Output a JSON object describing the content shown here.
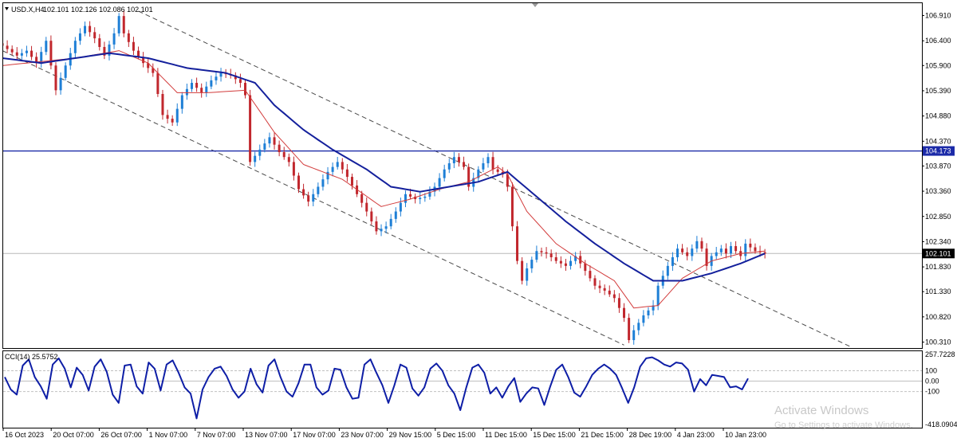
{
  "header": {
    "symbol": "USD.X,H4",
    "ohlc": "102.101 102.126 102.086 102.101"
  },
  "indicator": {
    "label": "CCI(14) 25.5752"
  },
  "watermark": {
    "line1": "Activate Windows",
    "line2": "Go to Settings to activate Windows."
  },
  "colors": {
    "bull": "#1e7fd6",
    "bear": "#c1272d",
    "ma_fast": "#d23b3b",
    "ma_slow": "#14209c",
    "hline": "#1b2aa8",
    "cci": "#0e1ea6",
    "channel": "#4a4a4a"
  },
  "chart_data": [
    {
      "type": "candlestick",
      "series_name": "USD.X,H4",
      "price_axis_ticks": [
        "106.910",
        "106.400",
        "105.900",
        "105.390",
        "104.880",
        "104.370",
        "103.870",
        "103.360",
        "102.850",
        "102.340",
        "101.830",
        "101.330",
        "100.820",
        "100.310"
      ],
      "ylim": [
        100.19,
        107.16
      ],
      "date_labels": [
        "16 Oct 2023",
        "20 Oct 07:00",
        "26 Oct 07:00",
        "1 Nov 07:00",
        "7 Nov 07:00",
        "13 Nov 07:00",
        "17 Nov 07:00",
        "23 Nov 07:00",
        "29 Nov 15:00",
        "5 Dec 15:00",
        "11 Dec 15:00",
        "15 Dec 15:00",
        "21 Dec 15:00",
        "28 Dec 19:00",
        "4 Jan 23:00",
        "10 Jan 23:00"
      ],
      "horizontal_line": 104.173,
      "current_price": 102.101,
      "close_path": [
        [
          0,
          106.3
        ],
        [
          3,
          106.1
        ],
        [
          5,
          106.2
        ],
        [
          7,
          105.95
        ],
        [
          9,
          106.4
        ],
        [
          10,
          105.9
        ],
        [
          11,
          105.4
        ],
        [
          13,
          105.9
        ],
        [
          15,
          106.4
        ],
        [
          17,
          106.7
        ],
        [
          19,
          106.45
        ],
        [
          21,
          106.1
        ],
        [
          23,
          106.55
        ],
        [
          24,
          106.9
        ],
        [
          25,
          106.55
        ],
        [
          27,
          106.2
        ],
        [
          29,
          105.95
        ],
        [
          31,
          105.75
        ],
        [
          33,
          104.9
        ],
        [
          35,
          104.75
        ],
        [
          37,
          105.3
        ],
        [
          39,
          105.55
        ],
        [
          41,
          105.35
        ],
        [
          43,
          105.6
        ],
        [
          45,
          105.75
        ],
        [
          47,
          105.7
        ],
        [
          49,
          105.55
        ],
        [
          50,
          105.3
        ],
        [
          51,
          103.95
        ],
        [
          53,
          104.2
        ],
        [
          55,
          104.45
        ],
        [
          57,
          104.15
        ],
        [
          59,
          103.95
        ],
        [
          61,
          103.4
        ],
        [
          63,
          103.15
        ],
        [
          65,
          103.45
        ],
        [
          67,
          103.75
        ],
        [
          69,
          103.95
        ],
        [
          71,
          103.65
        ],
        [
          73,
          103.3
        ],
        [
          75,
          102.95
        ],
        [
          77,
          102.55
        ],
        [
          79,
          102.65
        ],
        [
          81,
          102.95
        ],
        [
          83,
          103.3
        ],
        [
          85,
          103.2
        ],
        [
          87,
          103.25
        ],
        [
          89,
          103.45
        ],
        [
          91,
          103.8
        ],
        [
          93,
          104.05
        ],
        [
          95,
          103.85
        ],
        [
          96,
          103.45
        ],
        [
          98,
          103.8
        ],
        [
          100,
          104.05
        ],
        [
          101,
          103.8
        ],
        [
          103,
          103.7
        ],
        [
          104,
          103.45
        ],
        [
          105,
          102.65
        ],
        [
          106,
          101.95
        ],
        [
          107,
          101.55
        ],
        [
          108,
          101.8
        ],
        [
          110,
          102.15
        ],
        [
          112,
          102.1
        ],
        [
          114,
          101.95
        ],
        [
          116,
          101.85
        ],
        [
          118,
          102.05
        ],
        [
          120,
          101.75
        ],
        [
          122,
          101.45
        ],
        [
          124,
          101.35
        ],
        [
          126,
          101.2
        ],
        [
          128,
          100.8
        ],
        [
          129,
          100.35
        ],
        [
          130,
          100.55
        ],
        [
          132,
          100.85
        ],
        [
          134,
          101.05
        ],
        [
          135,
          101.45
        ],
        [
          137,
          101.85
        ],
        [
          139,
          102.2
        ],
        [
          141,
          102.05
        ],
        [
          143,
          102.35
        ],
        [
          144,
          102.2
        ],
        [
          145,
          101.85
        ],
        [
          146,
          102.05
        ],
        [
          148,
          102.2
        ],
        [
          149,
          102.1
        ],
        [
          150,
          102.25
        ],
        [
          152,
          102.05
        ],
        [
          153,
          102.3
        ],
        [
          155,
          102.15
        ],
        [
          157,
          102.1
        ]
      ],
      "moving_averages": [
        {
          "name": "MA fast",
          "points": [
            [
              0,
              105.9
            ],
            [
              8,
              105.98
            ],
            [
              15,
              106.05
            ],
            [
              24,
              106.2
            ],
            [
              30,
              105.95
            ],
            [
              36,
              105.35
            ],
            [
              42,
              105.35
            ],
            [
              50,
              105.4
            ],
            [
              56,
              104.55
            ],
            [
              62,
              103.9
            ],
            [
              70,
              103.6
            ],
            [
              78,
              103.05
            ],
            [
              84,
              103.2
            ],
            [
              90,
              103.4
            ],
            [
              96,
              103.55
            ],
            [
              102,
              103.85
            ],
            [
              104,
              103.7
            ],
            [
              108,
              102.95
            ],
            [
              114,
              102.3
            ],
            [
              120,
              101.9
            ],
            [
              126,
              101.55
            ],
            [
              130,
              101.0
            ],
            [
              135,
              101.05
            ],
            [
              140,
              101.6
            ],
            [
              146,
              101.95
            ],
            [
              152,
              102.1
            ],
            [
              157,
              102.15
            ]
          ]
        },
        {
          "name": "MA slow",
          "points": [
            [
              0,
              106.05
            ],
            [
              8,
              105.95
            ],
            [
              15,
              106.05
            ],
            [
              22,
              106.15
            ],
            [
              30,
              106.05
            ],
            [
              38,
              105.85
            ],
            [
              46,
              105.75
            ],
            [
              52,
              105.55
            ],
            [
              56,
              105.1
            ],
            [
              62,
              104.6
            ],
            [
              68,
              104.2
            ],
            [
              75,
              103.8
            ],
            [
              80,
              103.45
            ],
            [
              86,
              103.35
            ],
            [
              92,
              103.45
            ],
            [
              98,
              103.55
            ],
            [
              104,
              103.75
            ],
            [
              110,
              103.25
            ],
            [
              116,
              102.75
            ],
            [
              122,
              102.3
            ],
            [
              128,
              101.9
            ],
            [
              134,
              101.55
            ],
            [
              140,
              101.55
            ],
            [
              146,
              101.7
            ],
            [
              152,
              101.9
            ],
            [
              157,
              102.1
            ]
          ]
        }
      ],
      "channel_lines": [
        {
          "name": "upper",
          "points": [
            [
              28,
              107.0
            ],
            [
              175,
              100.2
            ]
          ]
        },
        {
          "name": "lower",
          "points": [
            [
              0,
              106.2
            ],
            [
              128,
              100.25
            ]
          ]
        }
      ]
    },
    {
      "type": "line",
      "series_name": "CCI(14)",
      "last_value": 25.5752,
      "y_ticks": [
        "257.7228",
        "100",
        "0.00",
        "-100",
        "-418.0904"
      ],
      "ylim": [
        -418.0904,
        257.7228
      ],
      "levels": [
        100,
        0,
        -100
      ],
      "values": [
        40,
        -80,
        -130,
        150,
        210,
        40,
        -50,
        -170,
        160,
        220,
        120,
        -60,
        130,
        60,
        -90,
        140,
        210,
        90,
        -130,
        -210,
        150,
        160,
        -50,
        -120,
        180,
        120,
        -90,
        160,
        200,
        80,
        -60,
        -120,
        -360,
        -80,
        40,
        120,
        140,
        50,
        -80,
        -160,
        -100,
        120,
        -30,
        -110,
        150,
        210,
        40,
        -100,
        -150,
        -20,
        160,
        160,
        -60,
        -130,
        -90,
        120,
        110,
        -60,
        -170,
        -160,
        160,
        210,
        80,
        -40,
        -210,
        -40,
        160,
        130,
        -70,
        -140,
        -60,
        120,
        170,
        100,
        -40,
        -120,
        -280,
        -60,
        130,
        160,
        80,
        -120,
        -60,
        -160,
        -50,
        30,
        -200,
        -120,
        -60,
        -70,
        -230,
        -50,
        110,
        160,
        40,
        -110,
        -150,
        -50,
        60,
        120,
        160,
        120,
        60,
        -70,
        -210,
        -60,
        140,
        220,
        230,
        200,
        160,
        140,
        180,
        170,
        110,
        -100,
        20,
        -40,
        60,
        50,
        40,
        -60,
        -50,
        -80,
        25.5752
      ]
    }
  ]
}
